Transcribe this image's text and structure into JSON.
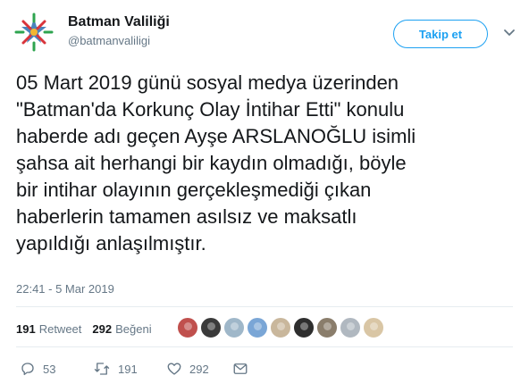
{
  "account": {
    "name": "Batman Valiliği",
    "handle": "@batmanvaliligi",
    "follow_label": "Takip et"
  },
  "tweet": {
    "text": "05 Mart 2019 günü sosyal medya üzerinden\n\"Batman'da Korkunç Olay İntihar Etti\" konulu\nhaberde adı geçen Ayşe ARSLANOĞLU isimli\nşahsa ait herhangi bir kaydın olmadığı, böyle\nbir intihar olayının gerçekleşmediği çıkan\nhaberlerin tamamen asılsız ve maksatlı\nyapıldığı anlaşılmıştır.",
    "timestamp": "22:41 - 5 Mar 2019"
  },
  "stats": {
    "retweets": "191",
    "retweets_label": "Retweet",
    "likes": "292",
    "likes_label": "Beğeni"
  },
  "likers": [
    "#c0504d",
    "#3a3a3a",
    "#9fb7c9",
    "#7aa6d6",
    "#c9b79c",
    "#2e2e2e",
    "#8a7d6b",
    "#b0b8c0",
    "#d9c6a5"
  ],
  "actions": {
    "replies": "53",
    "retweets": "191",
    "likes": "292"
  },
  "icons": {
    "reply": "reply-icon",
    "retweet": "retweet-icon",
    "like": "heart-icon",
    "message": "envelope-icon",
    "more": "chevron-down-icon"
  },
  "colors": {
    "accent": "#1da1f2",
    "muted": "#657786",
    "text": "#14171a"
  }
}
